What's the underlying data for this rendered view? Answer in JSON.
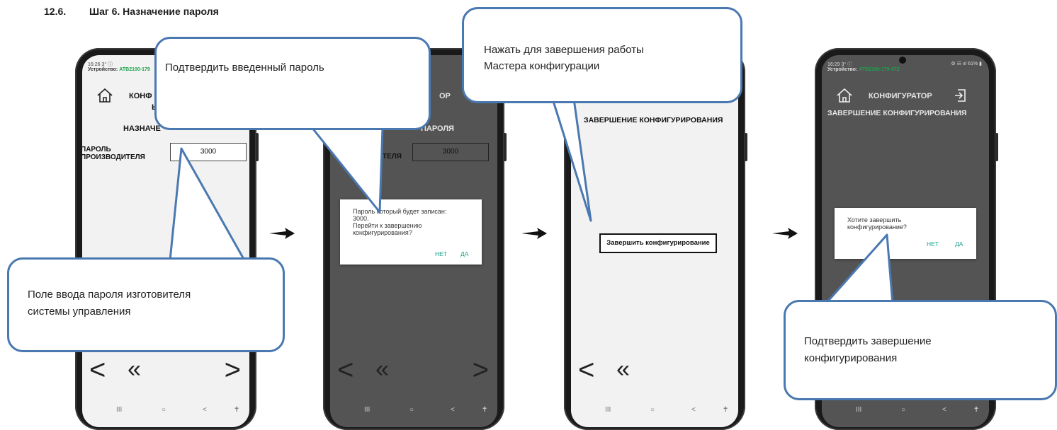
{
  "heading": {
    "number": "12.6.",
    "title": "Шаг 6. Назначение пароля"
  },
  "phone1": {
    "status_time": "16:26  3° ⓘ",
    "device_prefix": "Устройство: ",
    "device_id": "АТВ2100-179",
    "title_partial": "КОНФ",
    "title_second_line": "Ы",
    "section_partial": "НАЗНАЧЕ",
    "field_label_1": "ПАРОЛЬ",
    "field_label_2": "ПРОИЗВОДИТЕЛЯ",
    "field_value": "3000"
  },
  "phone2": {
    "title_partial": "ОР",
    "section_partial": "ПАРОЛЯ",
    "field_label_partial": "ТЕЛЯ",
    "field_value": "3000",
    "dialog_line1": "Пароль который будет записан:",
    "dialog_line2": "3000.",
    "dialog_line3": "Перейти к завершению",
    "dialog_line4": "конфигурирования?",
    "dialog_no": "НЕТ",
    "dialog_yes": "ДА"
  },
  "phone3": {
    "section_title": "ЗАВЕРШЕНИЕ КОНФИГУРИРОВАНИЯ",
    "finish_button": "Завершить конфигурирование"
  },
  "phone4": {
    "status_time": "16:29  3° ⓘ",
    "status_right": "⚙ ☷ ııl 61% ▮",
    "device_prefix": "Устройство: ",
    "device_id": "АТВ2100-179-072",
    "app_title": "КОНФИГУРАТОР",
    "section_title": "ЗАВЕРШЕНИЕ КОНФИГУРИРОВАНИЯ",
    "dialog_line1": "Хотите завершить",
    "dialog_line2": "конфигурирование?",
    "dialog_no": "НЕТ",
    "dialog_yes": "ДА"
  },
  "callouts": {
    "confirm_password": "Подтвердить введенный пароль",
    "finish_wizard_1": "Нажать для завершения работы",
    "finish_wizard_2": "Мастера конфигурации",
    "password_field_1": "Поле ввода пароля изготовителя",
    "password_field_2": "системы управления",
    "confirm_finish_1": "Подтвердить завершение",
    "confirm_finish_2": "конфигурирования"
  },
  "nav": {
    "back": "<",
    "first": "«",
    "next": ">",
    "sys_recent": "III",
    "sys_home": "○",
    "sys_back": "<",
    "sys_access": "✝"
  },
  "colors": {
    "callout_border": "#4a78b0",
    "device_id": "#1aa34a",
    "dialog_action": "#1aa38c"
  }
}
